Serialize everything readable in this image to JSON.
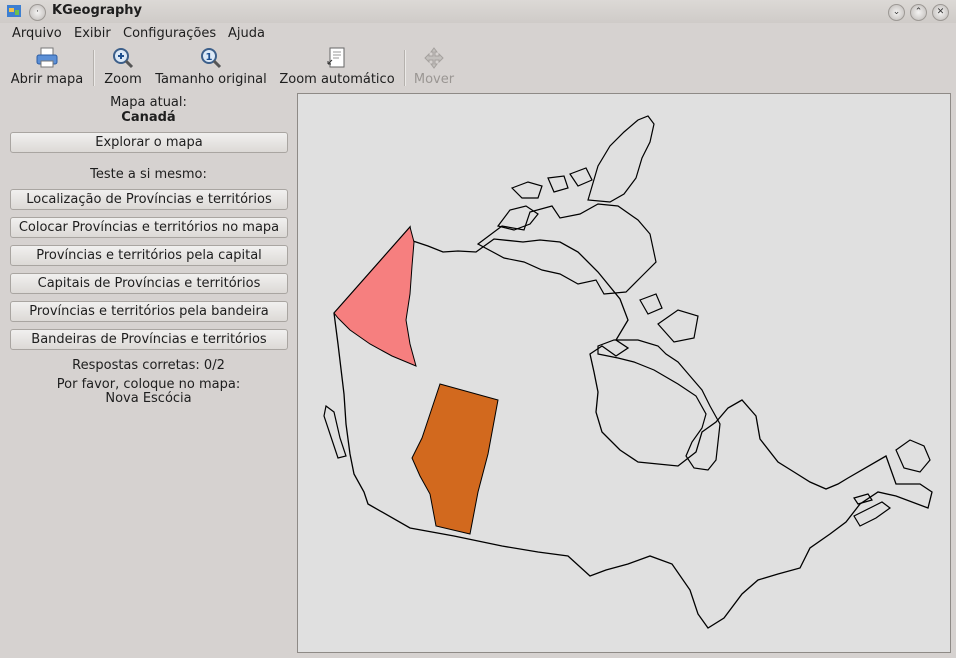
{
  "app": {
    "title": "KGeography"
  },
  "menu": {
    "arquivo": "Arquivo",
    "exibir": "Exibir",
    "configuracoes": "Configurações",
    "ajuda": "Ajuda"
  },
  "toolbar": {
    "open_map": "Abrir mapa",
    "zoom": "Zoom",
    "original_size": "Tamanho original",
    "auto_zoom": "Zoom automático",
    "move": "Mover"
  },
  "left_panel": {
    "current_map_label": "Mapa atual:",
    "current_map": "Canadá",
    "explore_button": "Explorar o mapa",
    "test_yourself": "Teste a si mesmo:",
    "quiz_buttons": [
      "Localização de Províncias e territórios",
      "Colocar Províncias e territórios no mapa",
      "Províncias e territórios pela capital",
      "Capitais de Províncias e territórios",
      "Províncias e territórios pela bandeira",
      "Bandeiras de Províncias e territórios"
    ],
    "correct_answers": "Respostas corretas: 0/2",
    "please_place": "Por favor, coloque no mapa:",
    "target": "Nova Escócia"
  },
  "map": {
    "yukon_fill": "#f67f7f",
    "alberta_fill": "#d2691e",
    "outline": "#000000",
    "background": "#e0e0e0"
  }
}
